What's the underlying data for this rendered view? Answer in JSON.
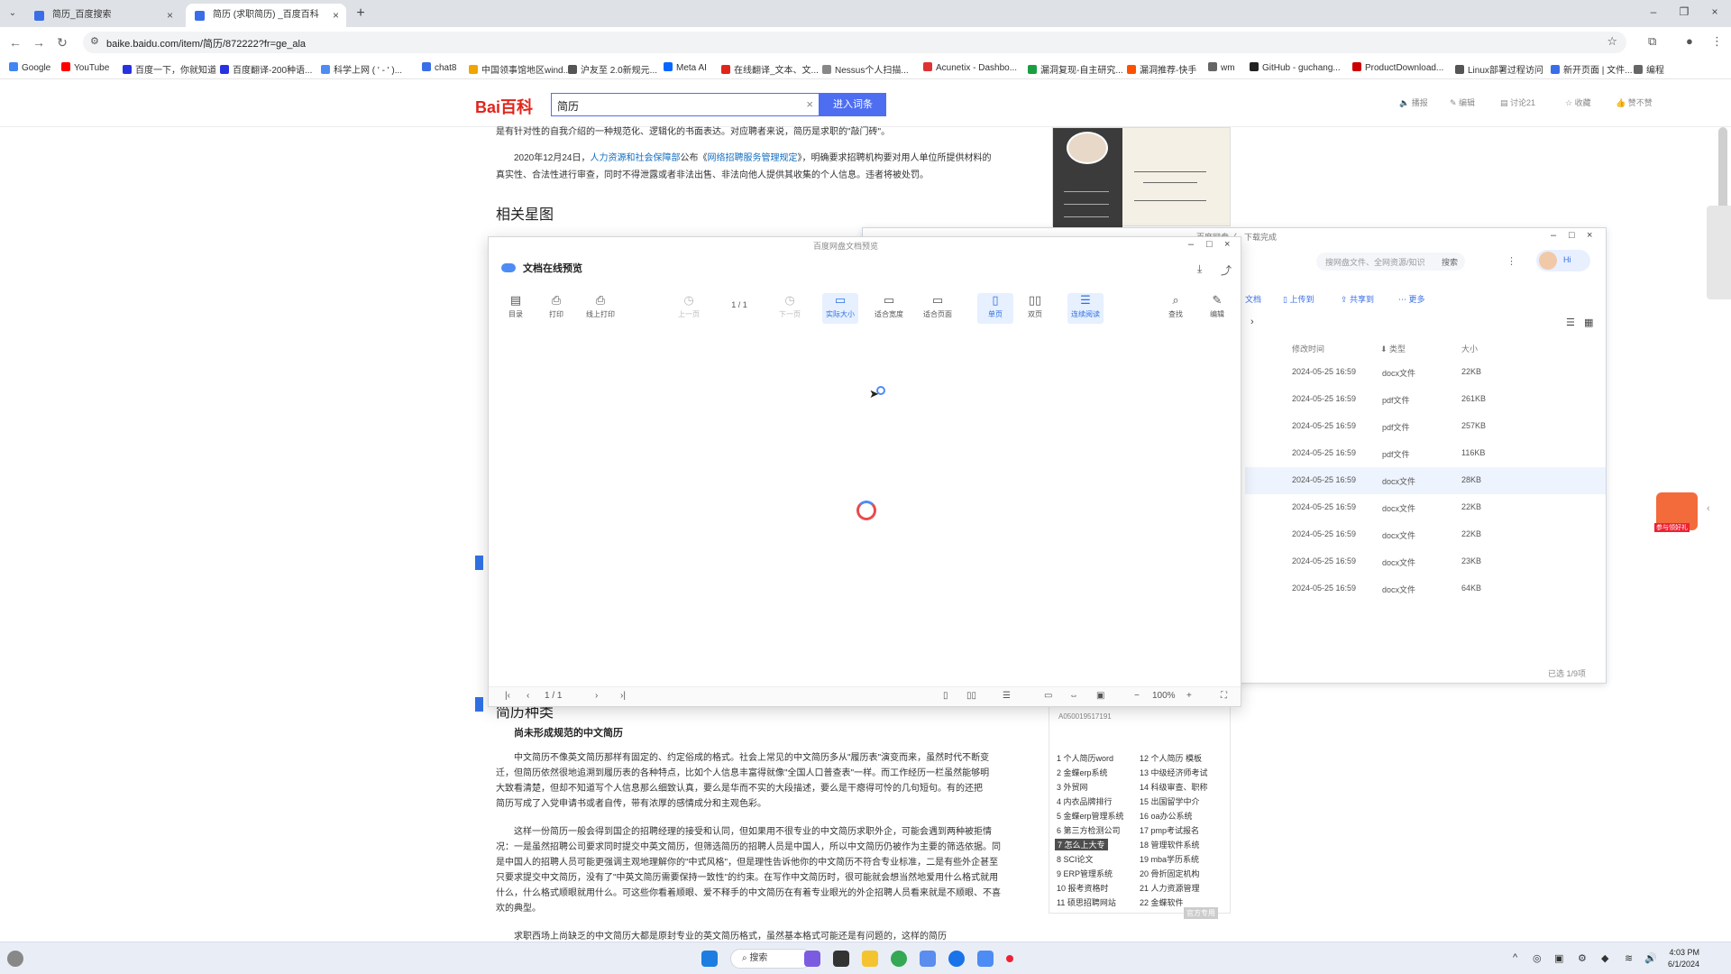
{
  "browser": {
    "tabs": [
      {
        "title": "简历_百度搜索",
        "active": false
      },
      {
        "title": "简历 (求职简历) _百度百科",
        "active": true
      }
    ],
    "url": "baike.baidu.com/item/简历/872222?fr=ge_ala",
    "bookmarks": [
      {
        "label": "Google",
        "color": "#4285f4"
      },
      {
        "label": "YouTube",
        "color": "#ff0000"
      },
      {
        "label": "百度一下，你就知道",
        "color": "#2932e1"
      },
      {
        "label": "百度翻译-200种语...",
        "color": "#2932e1"
      },
      {
        "label": "科学上网 ( ' - ' )...",
        "color": "#4e8cf5"
      },
      {
        "label": "chat8",
        "color": "#3a6ee8"
      },
      {
        "label": "中国领事馆地区wind...",
        "color": "#f0a500"
      },
      {
        "label": "沪友至 2.0新规元...",
        "color": "#555"
      },
      {
        "label": "Meta AI",
        "color": "#0866ff"
      },
      {
        "label": "在线翻译_文本、文...",
        "color": "#e1251b"
      },
      {
        "label": "Nessus个人扫描...",
        "color": "#888"
      },
      {
        "label": "Acunetix - Dashbo...",
        "color": "#d33"
      },
      {
        "label": "漏洞复现-自主研究...",
        "color": "#1a9e3f"
      },
      {
        "label": "漏洞推荐-快手",
        "color": "#ff5000"
      },
      {
        "label": "wm",
        "color": "#666"
      },
      {
        "label": "GitHub - guchang...",
        "color": "#222"
      },
      {
        "label": "ProductDownload...",
        "color": "#c00"
      },
      {
        "label": "Linux部署过程访问",
        "color": "#555"
      },
      {
        "label": "新开页面 | 文件...",
        "color": "#3a6ee8"
      },
      {
        "label": "编程",
        "color": "#666"
      }
    ]
  },
  "baike": {
    "logo": "Bai百科",
    "search_value": "简历",
    "enter_label": "进入词条",
    "header_actions": [
      "播报",
      "编辑",
      "讨论21",
      "收藏",
      "赞不赞"
    ],
    "para1": "是有针对性的自我介绍的一种规范化、逻辑化的书面表达。对应聘者来说，简历是求职的\"敲门砖\"。",
    "para2a_pre": "2020年12月24日，",
    "para2a_link1": "人力资源和社会保障部",
    "para2a_mid": "公布《",
    "para2a_link2": "网络招聘服务管理规定",
    "para2a_post": "》，明确要求招聘机构要对用人单位所提供材料的",
    "para2b": "真实性、合法性进行审查，同时不得泄露或者非法出售、非法向他人提供其收集的个人信息。违者将被处罚。",
    "section_related": "相关星图",
    "section_types": "简历种类",
    "sub_chinese": "尚未形成规范的中文简历",
    "body_lines": [
      "中文简历不像英文简历那样有固定的、约定俗成的格式。社会上常见的中文简历多从\"履历表\"演变而来，虽然时代不断变",
      "迁，但简历依然很地追溯到履历表的各种特点，比如个人信息丰富得就像\"全国人口普查表\"一样。而工作经历一栏虽然能够明",
      "大致看清楚，但却不知道写个人信息那么细致认真，要么是华而不实的大段描述，要么是干瘪得可怜的几句短句。有的还把",
      "简历写成了入党申请书或者自传，带有浓厚的感情成分和主观色彩。",
      "这样一份简历一般会得到国企的招聘经理的接受和认同，但如果用不很专业的中文简历求职外企，可能会遇到两种被拒情",
      "况：一是虽然招聘公司要求同时提交中英文简历，但筛选简历的招聘人员是中国人，所以中文简历仍被作为主要的筛选依据。同",
      "是中国人的招聘人员可能更强调主观地理解你的\"中式风格\"，但是理性告诉他你的中文简历不符合专业标准，二是有些外企甚至",
      "只要求提交中文简历，没有了\"中英文简历需要保持一致性\"的约束。在写作中文简历时，很可能就会想当然地爱用什么格式就用",
      "什么，什么格式顺眼就用什么。可这些你看着顺眼、爱不释手的中文简历在有着专业眼光的外企招聘人员看来就是不顺眼、不喜",
      "欢的典型。"
    ],
    "last_line": "求职西场上尚缺乏的中文简历大都是原封专业的英文简历格式，虽然基本格式可能还是有问题的，这样的简历",
    "sidebar_id": "A050019517191",
    "ranks_left": [
      "1 个人简历word",
      "2 金蝶erp系统",
      "3 外贸网",
      "4 内衣品牌排行",
      "5 金蝶erp管理系统",
      "6 第三方检测公司",
      "7 怎么上大专",
      "8 SCI论文",
      "9 ERP管理系统",
      "10 报考资格时",
      "11 硕思招聘网站"
    ],
    "ranks_right": [
      "12 个人简历 模板",
      "13 中级经济师考试",
      "14 科级审查、职称",
      "15 出国留学中介",
      "16 oa办公系统",
      "17 pmp考试报名",
      "18 管理软件系统",
      "19 mba学历系统",
      "20 骨折固定机构",
      "21 人力资源管理",
      "22 金蝶软件"
    ],
    "watermark": "官方专用"
  },
  "file_manager": {
    "title": "百度网盘（ - 下载完成",
    "search_placeholder": "搜网盘文件、全网资源/知识",
    "search_btn": "搜索",
    "user_hi": "Hi",
    "toolbar": [
      "文档",
      "上传到",
      "共享到",
      "更多"
    ],
    "columns": [
      "修改时间",
      "类型",
      "大小"
    ],
    "rows": [
      {
        "time": "2024-05-25 16:59",
        "type": "docx文件",
        "size": "22KB",
        "selected": false
      },
      {
        "time": "2024-05-25 16:59",
        "type": "pdf文件",
        "size": "261KB",
        "selected": false
      },
      {
        "time": "2024-05-25 16:59",
        "type": "pdf文件",
        "size": "257KB",
        "selected": false
      },
      {
        "time": "2024-05-25 16:59",
        "type": "pdf文件",
        "size": "116KB",
        "selected": false
      },
      {
        "time": "2024-05-25 16:59",
        "type": "docx文件",
        "size": "28KB",
        "selected": true
      },
      {
        "time": "2024-05-25 16:59",
        "type": "docx文件",
        "size": "22KB",
        "selected": false
      },
      {
        "time": "2024-05-25 16:59",
        "type": "docx文件",
        "size": "22KB",
        "selected": false
      },
      {
        "time": "2024-05-25 16:59",
        "type": "docx文件",
        "size": "23KB",
        "selected": false
      },
      {
        "time": "2024-05-25 16:59",
        "type": "docx文件",
        "size": "64KB",
        "selected": false
      }
    ],
    "status": "已选 1/9项"
  },
  "preview": {
    "window_title": "百度网盘文档预览",
    "header": "文档在线预览",
    "tools": [
      {
        "label": "目录",
        "icon": "▤"
      },
      {
        "label": "打印",
        "icon": "⎙"
      },
      {
        "label": "线上打印",
        "icon": "⎙"
      },
      {
        "label": "上一页",
        "icon": "◷"
      },
      {
        "label": "下一页",
        "icon": "◷"
      },
      {
        "label": "实际大小",
        "icon": "▭"
      },
      {
        "label": "适合宽度",
        "icon": "▭"
      },
      {
        "label": "适合页面",
        "icon": "▭"
      },
      {
        "label": "单页",
        "icon": "▯"
      },
      {
        "label": "双页",
        "icon": "▯▯"
      },
      {
        "label": "连续阅读",
        "icon": "☰"
      },
      {
        "label": "查找",
        "icon": "⌕"
      },
      {
        "label": "编辑",
        "icon": "✎"
      }
    ],
    "page_indicator": "1 / 1",
    "bottom_page": "1 / 1",
    "zoom": "100%"
  },
  "taskbar": {
    "search_label": "搜索",
    "time": "4:03 PM",
    "date": "6/1/2024"
  },
  "gift_label": "参与领好礼"
}
